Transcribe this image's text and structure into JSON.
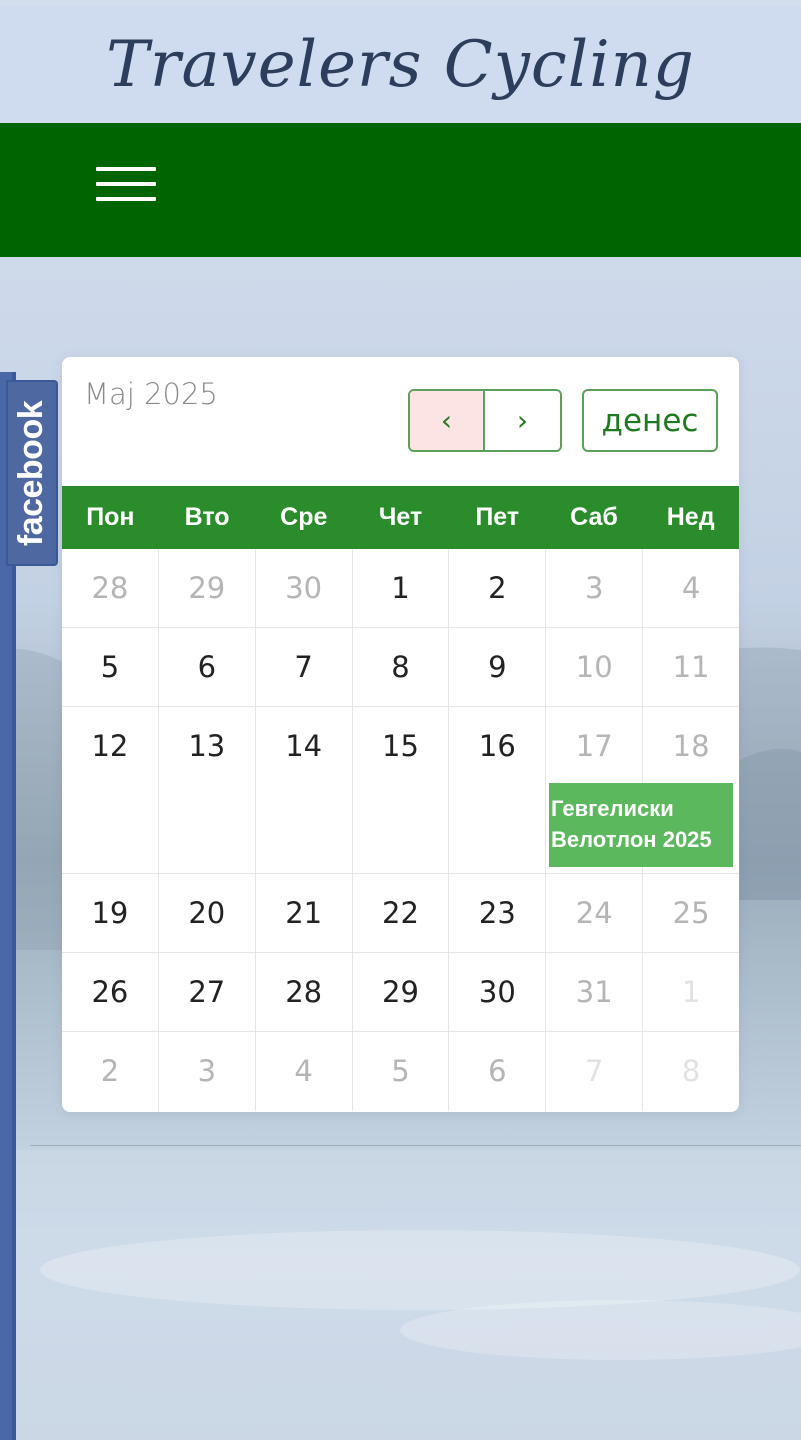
{
  "site": {
    "title": "Travelers Cycling"
  },
  "facebook": {
    "label": "facebook"
  },
  "calendar": {
    "month_label": "Maj 2025",
    "prev_label": "‹",
    "next_label": "›",
    "today_label": "денес",
    "weekdays": [
      "Пон",
      "Вто",
      "Сре",
      "Чет",
      "Пет",
      "Саб",
      "Нед"
    ],
    "weeks": [
      [
        "28",
        "29",
        "30",
        "1",
        "2",
        "3",
        "4"
      ],
      [
        "5",
        "6",
        "7",
        "8",
        "9",
        "10",
        "11"
      ],
      [
        "12",
        "13",
        "14",
        "15",
        "16",
        "17",
        "18"
      ],
      [
        "19",
        "20",
        "21",
        "22",
        "23",
        "24",
        "25"
      ],
      [
        "26",
        "27",
        "28",
        "29",
        "30",
        "31",
        "1"
      ],
      [
        "2",
        "3",
        "4",
        "5",
        "6",
        "7",
        "8"
      ]
    ],
    "event": {
      "title": "Гевгелиски Велотлон 2025"
    }
  },
  "colors": {
    "navbar": "#006400",
    "calendar_header": "#2a8c2a",
    "event": "#5cb85c",
    "prev_button_active": "#fde4e4",
    "facebook": "#4e69a2"
  },
  "icons": {
    "menu": "hamburger-menu-icon"
  }
}
